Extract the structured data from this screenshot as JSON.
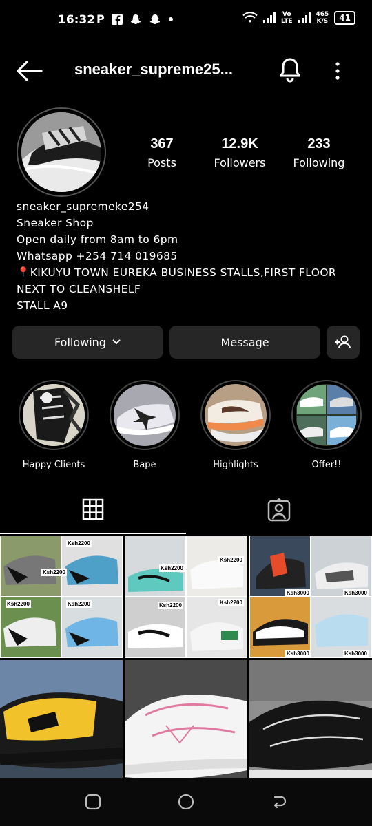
{
  "status": {
    "time": "16:32",
    "notif_letter": "P",
    "network_speed_top": "465",
    "network_speed_bottom": "K/S",
    "lte_top": "Vo",
    "lte_bottom": "LTE",
    "battery": "41"
  },
  "header": {
    "username": "sneaker_supreme25..."
  },
  "stats": [
    {
      "value": "367",
      "label": "Posts"
    },
    {
      "value": "12.9K",
      "label": "Followers"
    },
    {
      "value": "233",
      "label": "Following"
    }
  ],
  "bio": {
    "name": "sneaker_supremeke254",
    "category": "Sneaker Shop",
    "line1": "Open daily from 8am to 6pm",
    "line2": "Whatsapp +254 714 019685",
    "line3": "📍KIKUYU TOWN EUREKA BUSINESS STALLS,FIRST FLOOR",
    "line4": "NEXT TO CLEANSHELF",
    "line5": "STALL A9"
  },
  "actions": {
    "following_label": "Following",
    "message_label": "Message"
  },
  "highlights": [
    {
      "label": "Happy Clients"
    },
    {
      "label": "Bape"
    },
    {
      "label": "Highlights"
    },
    {
      "label": "Offer!!"
    }
  ],
  "posts": {
    "price_2200": "Ksh2200",
    "price_3000": "Ksh3000"
  },
  "colors": {
    "background": "#000000",
    "button_bg": "#262626"
  }
}
